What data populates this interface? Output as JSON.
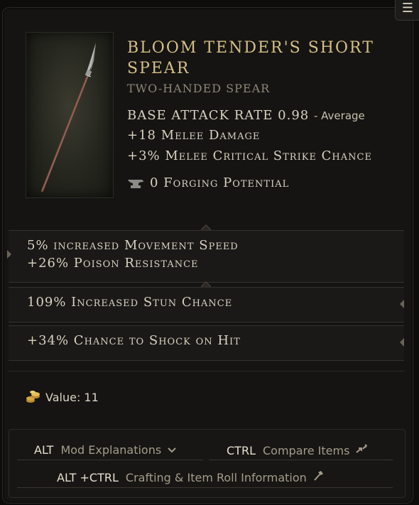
{
  "menu_icon": "hamburger-icon",
  "item": {
    "name": "BLOOM TENDER'S SHORT SPEAR",
    "type": "TWO-HANDED SPEAR",
    "base_attack_rate_label": "BASE ATTACK RATE 0.98",
    "base_attack_rate_rating": "- Average",
    "implicits": [
      "+18 Melee Damage",
      "+3% Melee Critical Strike Chance"
    ],
    "forging_potential": "0 Forging Potential",
    "forging_icon": "anvil-icon",
    "image_icon": "spear-icon"
  },
  "affixes": {
    "group1": [
      "5% increased Movement Speed",
      "+26% Poison Resistance"
    ],
    "group2": "109% Increased Stun Chance",
    "group3": "+34% Chance to Shock on Hit"
  },
  "value": {
    "label": "Value: 11",
    "icon": "gold-coins-icon"
  },
  "hints": {
    "mod_key": "ALT",
    "mod_desc": "Mod Explanations",
    "mod_icon": "chevron-down-icon",
    "compare_key": "CTRL",
    "compare_desc": "Compare Items",
    "compare_icon": "compare-arrows-icon",
    "craft_key": "ALT +CTRL",
    "craft_desc": "Crafting & Item Roll Information",
    "craft_icon": "hammer-icon"
  },
  "colors": {
    "title": "#d6bf87",
    "text": "#d9d2c0",
    "muted": "#8f8774",
    "background": "#151413"
  }
}
